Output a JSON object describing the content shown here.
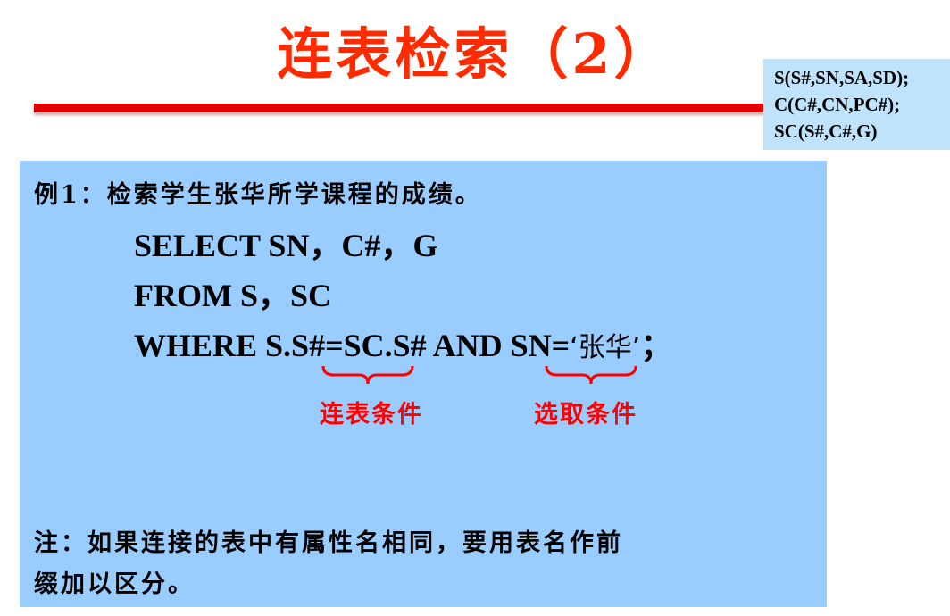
{
  "slide": {
    "title": "连表检索（2）",
    "title_color": "#ff2a00",
    "rule_color": "#e00000"
  },
  "schema": {
    "lines": [
      "S(S#,SN,SA,SD);",
      "C(C#,CN,PC#);",
      "SC(S#,C#,G)"
    ],
    "background": "#bfe3fb"
  },
  "example": {
    "heading": "例1：检索学生张华所学课程的成绩。",
    "sql_select": "SELECT  SN，C#，G",
    "sql_from": "FROM   S，SC",
    "sql_where_prefix": "WHERE S.S#=SC.S# AND SN=",
    "sql_where_literal": "‘张华’",
    "sql_where_suffix": "；",
    "background": "#99ccff"
  },
  "annotations": {
    "join_condition": "连表条件",
    "select_condition": "选取条件",
    "color": "#ff0000"
  },
  "note": {
    "line1": "注：如果连接的表中有属性名相同，要用表名作前",
    "line2": "缀加以区分。"
  }
}
